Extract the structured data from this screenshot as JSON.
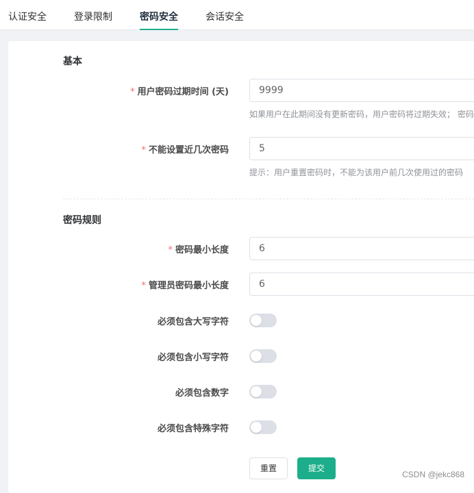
{
  "tabs": [
    {
      "label": "认证安全",
      "active": false
    },
    {
      "label": "登录限制",
      "active": false
    },
    {
      "label": "密码安全",
      "active": true
    },
    {
      "label": "会话安全",
      "active": false
    }
  ],
  "basic": {
    "title": "基本",
    "expire_days": {
      "label": "用户密码过期时间 (天)",
      "value": "9999",
      "hint": "如果用户在此期间没有更新密码，用户密码将过期失效； 密码",
      "required": true
    },
    "history_count": {
      "label": "不能设置近几次密码",
      "value": "5",
      "hint": "提示：用户重置密码时，不能为该用户前几次使用过的密码",
      "required": true
    }
  },
  "rules": {
    "title": "密码规则",
    "min_length": {
      "label": "密码最小长度",
      "value": "6",
      "required": true
    },
    "admin_min_length": {
      "label": "管理员密码最小长度",
      "value": "6",
      "required": true
    },
    "require_uppercase": {
      "label": "必须包含大写字符",
      "enabled": false
    },
    "require_lowercase": {
      "label": "必须包含小写字符",
      "enabled": false
    },
    "require_digit": {
      "label": "必须包含数字",
      "enabled": false
    },
    "require_special": {
      "label": "必须包含特殊字符",
      "enabled": false
    }
  },
  "required_mark": "*",
  "actions": {
    "reset": "重置",
    "submit": "提交"
  },
  "watermark": "CSDN @jekc868",
  "colors": {
    "accent": "#1cae8a",
    "required": "#f56c6c",
    "switch_off": "#dcdfe6"
  }
}
